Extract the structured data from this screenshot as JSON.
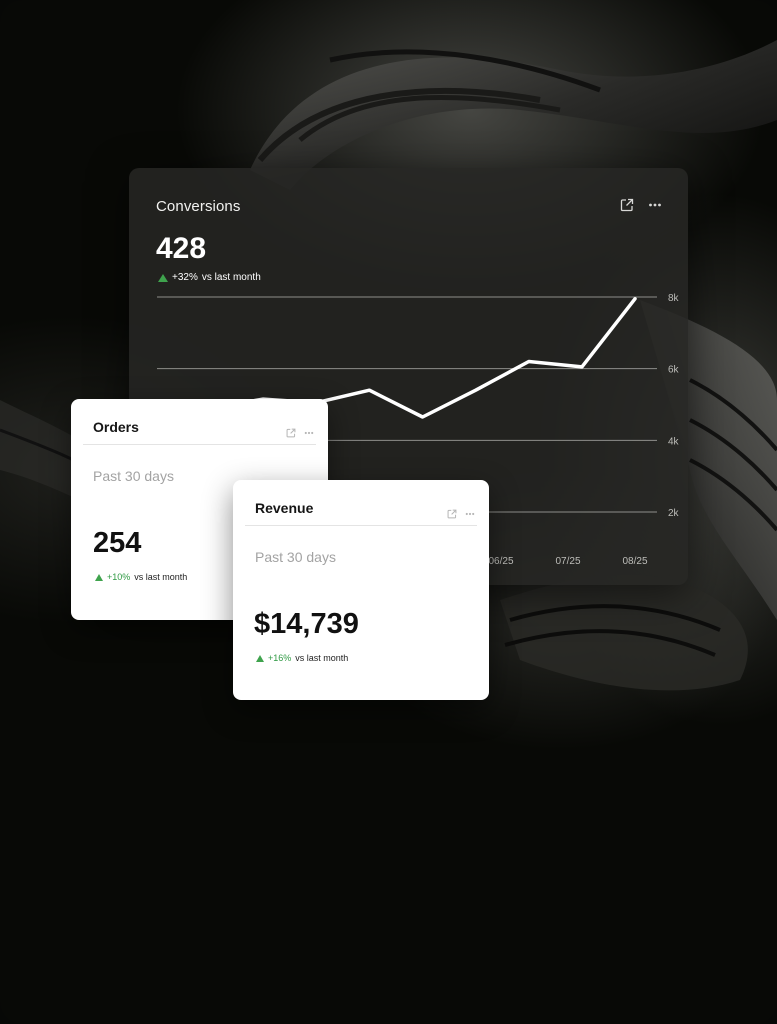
{
  "conversions": {
    "title": "Conversions",
    "value": "428",
    "delta_pct": "+32%",
    "delta_text": "vs last month",
    "icons": [
      "external-link-icon",
      "more-icon"
    ]
  },
  "chart_data": {
    "type": "line",
    "title": "",
    "xlabel": "",
    "ylabel": "",
    "x_ticks": [
      "06/25",
      "07/25",
      "08/25"
    ],
    "y_ticks": [
      "2k",
      "4k",
      "6k",
      "8k"
    ],
    "ylim": [
      2000,
      8000
    ],
    "grid": true,
    "series": [
      {
        "values": [
          4500,
          4900,
          5150,
          5050,
          5400,
          4650,
          5400,
          6200,
          6050,
          7950
        ]
      }
    ]
  },
  "orders": {
    "title": "Orders",
    "period": "Past 30 days",
    "value": "254",
    "delta_pct": "+10%",
    "delta_text": "vs last month"
  },
  "revenue": {
    "title": "Revenue",
    "period": "Past 30 days",
    "value": "$14,739",
    "delta_pct": "+16%",
    "delta_text": "vs last month"
  },
  "colors": {
    "accent_green": "#3fa34d",
    "panel_dark": "#262624",
    "card_white": "#ffffff"
  }
}
